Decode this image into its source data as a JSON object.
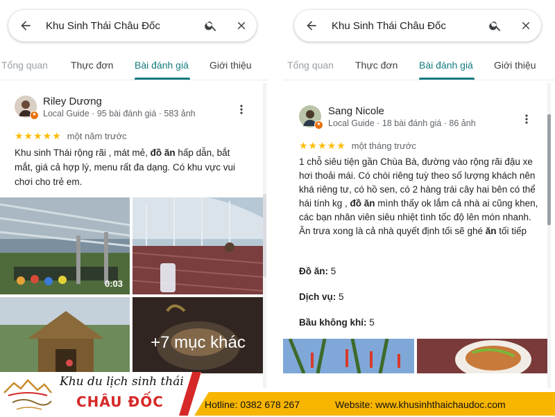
{
  "search": {
    "query": "Khu Sinh Thái Châu Đốc"
  },
  "tabs": [
    "Tổng quan",
    "Thực đơn",
    "Bài đánh giá",
    "Giới thiệu"
  ],
  "left_review": {
    "author": "Riley Dương",
    "meta": "Local Guide · 95 bài đánh giá · 583 ảnh",
    "rating": 5,
    "stars": "★★★★★",
    "time": "một năm trước",
    "text_before": "Khu sinh Thái rộng rãi , mát mẻ, ",
    "text_bold": "đồ ăn",
    "text_after": " hấp dẫn, bắt mắt, giá cả hợp lý, menu rất đa dạng. Có khu vực vui chơi cho trẻ em.",
    "video_duration": "0:03",
    "more_photos": "+7 mục khác"
  },
  "right_review": {
    "author": "Sang Nicole",
    "meta": "Local Guide · 18 bài đánh giá · 86 ảnh",
    "rating": 5,
    "stars": "★★★★★",
    "time": "một tháng trước",
    "text_part1": "1 chỗ siêu tiện gần Chùa Bà, đường vào rộng rãi đậu xe hơi thoải mái. Có chòi riêng tuỳ theo số lượng khách nên khá riêng tư, có hồ sen, có 2 hàng trái cây hai bên có thể hái tính kg , ",
    "text_bold1": "đồ ăn",
    "text_part2": " mình thấy ok lắm cả nhà ai cũng khen, các bạn nhân viên siêu nhiệt tình tốc độ lên món nhanh. Ăn trưa xong là cả nhà quyết định tối sẽ ghé ",
    "text_bold2": "ăn",
    "text_part3": " tối tiếp",
    "attributes": [
      {
        "label": "Đồ ăn:",
        "value": "5"
      },
      {
        "label": "Dịch vụ:",
        "value": "5"
      },
      {
        "label": "Bầu không khí:",
        "value": "5"
      }
    ]
  },
  "banner": {
    "script_line": "Khu du lịch sinh thái",
    "title": "CHÂU ĐỐC",
    "hotline": "Hotline: 0382 678 267",
    "website": "Website: www.khusinhthaichaudoc.com"
  },
  "colors": {
    "accent": "#137a7f",
    "star": "#fbbc04",
    "banner_red": "#d62828",
    "banner_yellow": "#f7b500"
  }
}
